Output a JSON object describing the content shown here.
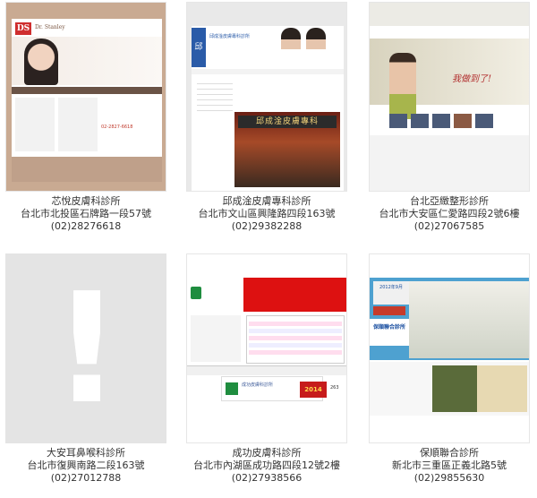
{
  "clinics": [
    {
      "name": "芯悅皮膚科診所",
      "address": "台北市北投區石牌路一段57號",
      "phone": "(02)28276618",
      "thumb": {
        "brand": "Dr. Stanley",
        "logo": "DS",
        "phone_text": "02-2827-6618"
      }
    },
    {
      "name": "邱成淦皮膚專科診所",
      "address": "台北市文山區興隆路四段163號",
      "phone": "(02)29382288",
      "thumb": {
        "logo": "邱",
        "sign": "邱成淦皮膚專科",
        "header": "邱成淦皮膚專科診所"
      }
    },
    {
      "name": "台北亞緻整形診所",
      "address": "台北市大安區仁愛路四段2號6樓",
      "phone": "(02)27067585",
      "thumb": {
        "slogan": "我做到了!"
      }
    },
    {
      "name": "大安耳鼻喉科診所",
      "address": "台北市復興南路二段163號",
      "phone": "(02)27012788",
      "thumb": {
        "placeholder_glyph": "!"
      }
    },
    {
      "name": "成功皮膚科診所",
      "address": "台北市內湖區成功路四段12號2樓",
      "phone": "(02)27938566",
      "thumb": {
        "clinic": "成功皮膚科診所",
        "ad": "2014",
        "count": "263"
      }
    },
    {
      "name": "保順聯合診所",
      "address": "新北市三重區正義北路5號",
      "phone": "(02)29855630",
      "thumb": {
        "year_text": "2012年9月",
        "badge": "保順聯合診所"
      }
    }
  ]
}
